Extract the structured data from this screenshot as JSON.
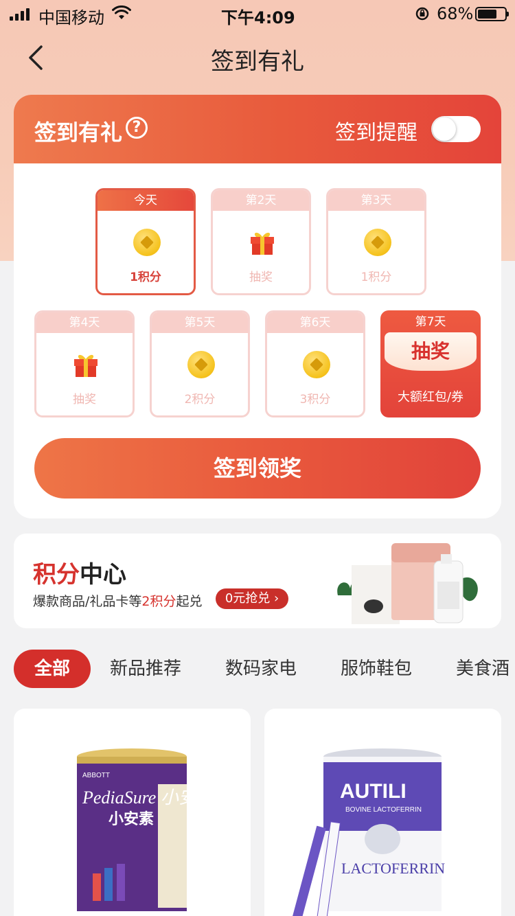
{
  "status_bar": {
    "carrier": "中国移动",
    "time": "下午4:09",
    "battery": "68%"
  },
  "nav": {
    "title": "签到有礼"
  },
  "sign_card": {
    "title": "签到有礼",
    "help_symbol": "?",
    "reminder_label": "签到提醒",
    "reminder_on": false,
    "days": [
      {
        "label": "今天",
        "reward": "1积分",
        "icon": "coin-icon"
      },
      {
        "label": "第2天",
        "reward": "抽奖",
        "icon": "gift-icon"
      },
      {
        "label": "第3天",
        "reward": "1积分",
        "icon": "coin-icon"
      },
      {
        "label": "第4天",
        "reward": "抽奖",
        "icon": "gift-icon"
      },
      {
        "label": "第5天",
        "reward": "2积分",
        "icon": "coin-icon"
      },
      {
        "label": "第6天",
        "reward": "3积分",
        "icon": "coin-icon"
      },
      {
        "label": "第7天",
        "reward": "大额红包/券",
        "badge": "抽奖"
      }
    ],
    "button_label": "签到领奖"
  },
  "points_center": {
    "title_red": "积分",
    "title_black": "中心",
    "desc_prefix": "爆款商品/礼品卡等",
    "desc_red": "2积分",
    "desc_suffix": "起兑",
    "exchange_label": "0元抢兑"
  },
  "tabs": [
    "全部",
    "新品推荐",
    "数码家电",
    "服饰鞋包",
    "美食酒"
  ],
  "products": [
    {
      "name": "PediaSure 小安素",
      "brand": "ABBOTT",
      "product_label": "小安素",
      "image": "pediasure-can"
    },
    {
      "name": "AUTILI LACTOFERRIN",
      "brand": "AUTILI",
      "product_label": "LACTOFERRIN",
      "subtitle": "BOVINE LACTOFERRIN",
      "image": "autili-can"
    }
  ],
  "colors": {
    "accent_red": "#e4443a",
    "brand_orange": "#ee7a4e",
    "coin_gold": "#f5c21c",
    "tab_active": "#d42f2b"
  }
}
